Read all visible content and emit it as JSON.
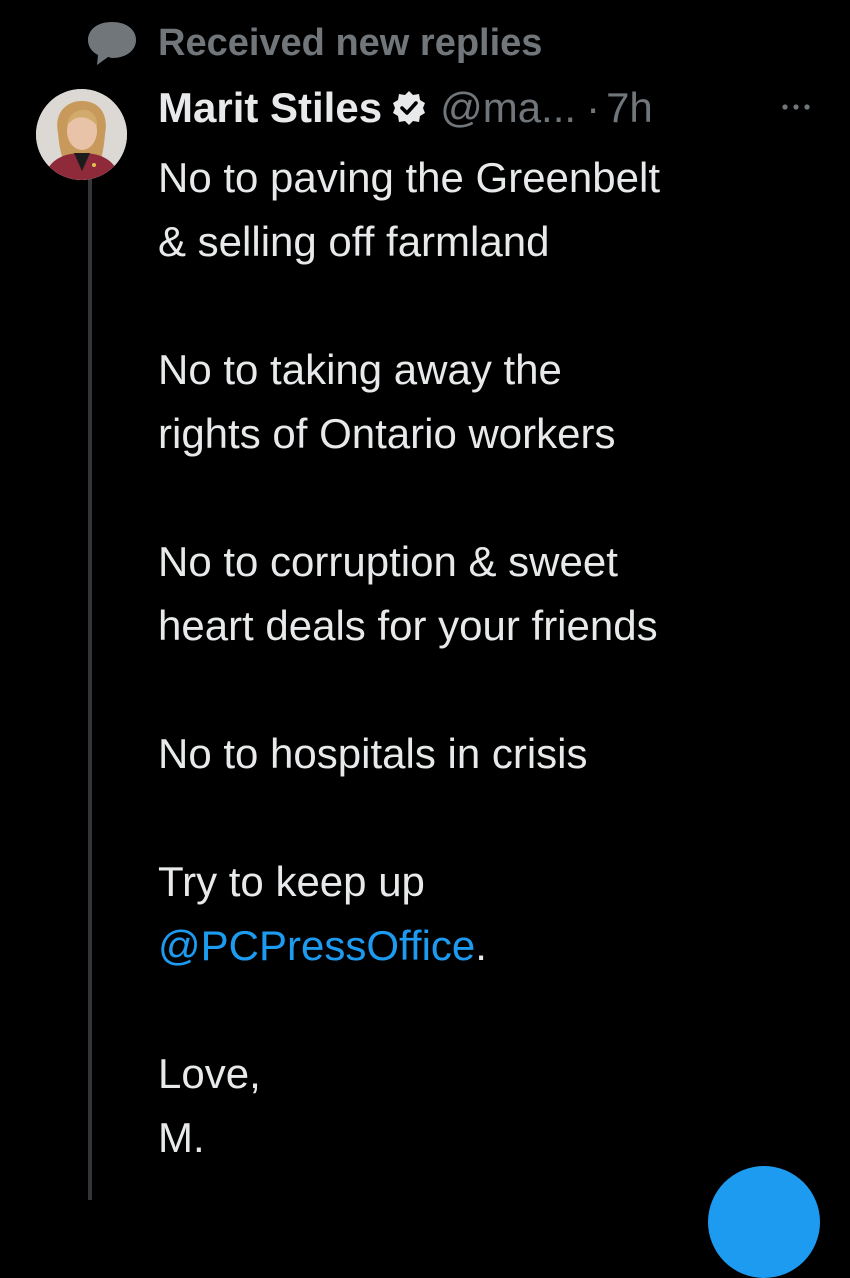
{
  "context": {
    "label": "Received new replies",
    "icon": "speech-bubble-icon"
  },
  "tweet": {
    "author": {
      "name": "Marit Stiles",
      "handle": "@ma...",
      "verified": true,
      "avatar_icon": "profile-photo"
    },
    "separator": "·",
    "time": "7h",
    "more_icon": "more-options-icon",
    "lines": [
      "No to paving the Greenbelt",
      "& selling off farmland",
      "No to taking away the",
      "rights of Ontario workers",
      "No to corruption & sweet",
      "heart deals for your friends",
      "No to hospitals in crisis",
      "Try to keep up"
    ],
    "mention": "@PCPressOffice",
    "mention_suffix": ".",
    "signoff": [
      "Love,",
      "M."
    ]
  },
  "colors": {
    "background": "#000000",
    "text": "#e7e9ea",
    "muted": "#71767b",
    "accent": "#1d9bf0"
  },
  "fab_icon": "compose-button"
}
